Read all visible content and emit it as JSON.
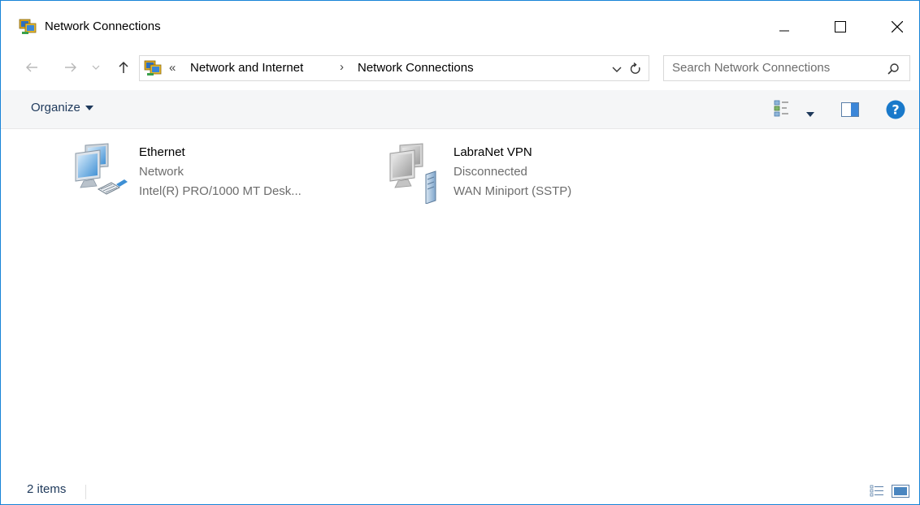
{
  "window": {
    "title": "Network Connections",
    "title_icon": "network-connections-icon"
  },
  "nav": {
    "back": "back-arrow-icon",
    "forward": "forward-arrow-icon",
    "recent": "recent-locations-chevron-icon",
    "up": "up-arrow-icon",
    "overflow_chevron": "«",
    "breadcrumbs": [
      "Network and Internet",
      "Network Connections"
    ],
    "breadcrumb_separator": "›",
    "search_placeholder": "Search Network Connections"
  },
  "toolbar": {
    "organize_label": "Organize"
  },
  "connections": [
    {
      "name": "Ethernet",
      "status": "Network",
      "device": "Intel(R) PRO/1000 MT Desk...",
      "icon": "ethernet-connection-icon"
    },
    {
      "name": "LabraNet VPN",
      "status": "Disconnected",
      "device": "WAN Miniport (SSTP)",
      "icon": "vpn-connection-icon"
    }
  ],
  "status": {
    "item_count": "2 items"
  },
  "colors": {
    "window_border": "#1883d7",
    "command_bar_bg": "#f5f6f7",
    "secondary_text": "#6d6d6d",
    "help_blue": "#1979ca"
  }
}
